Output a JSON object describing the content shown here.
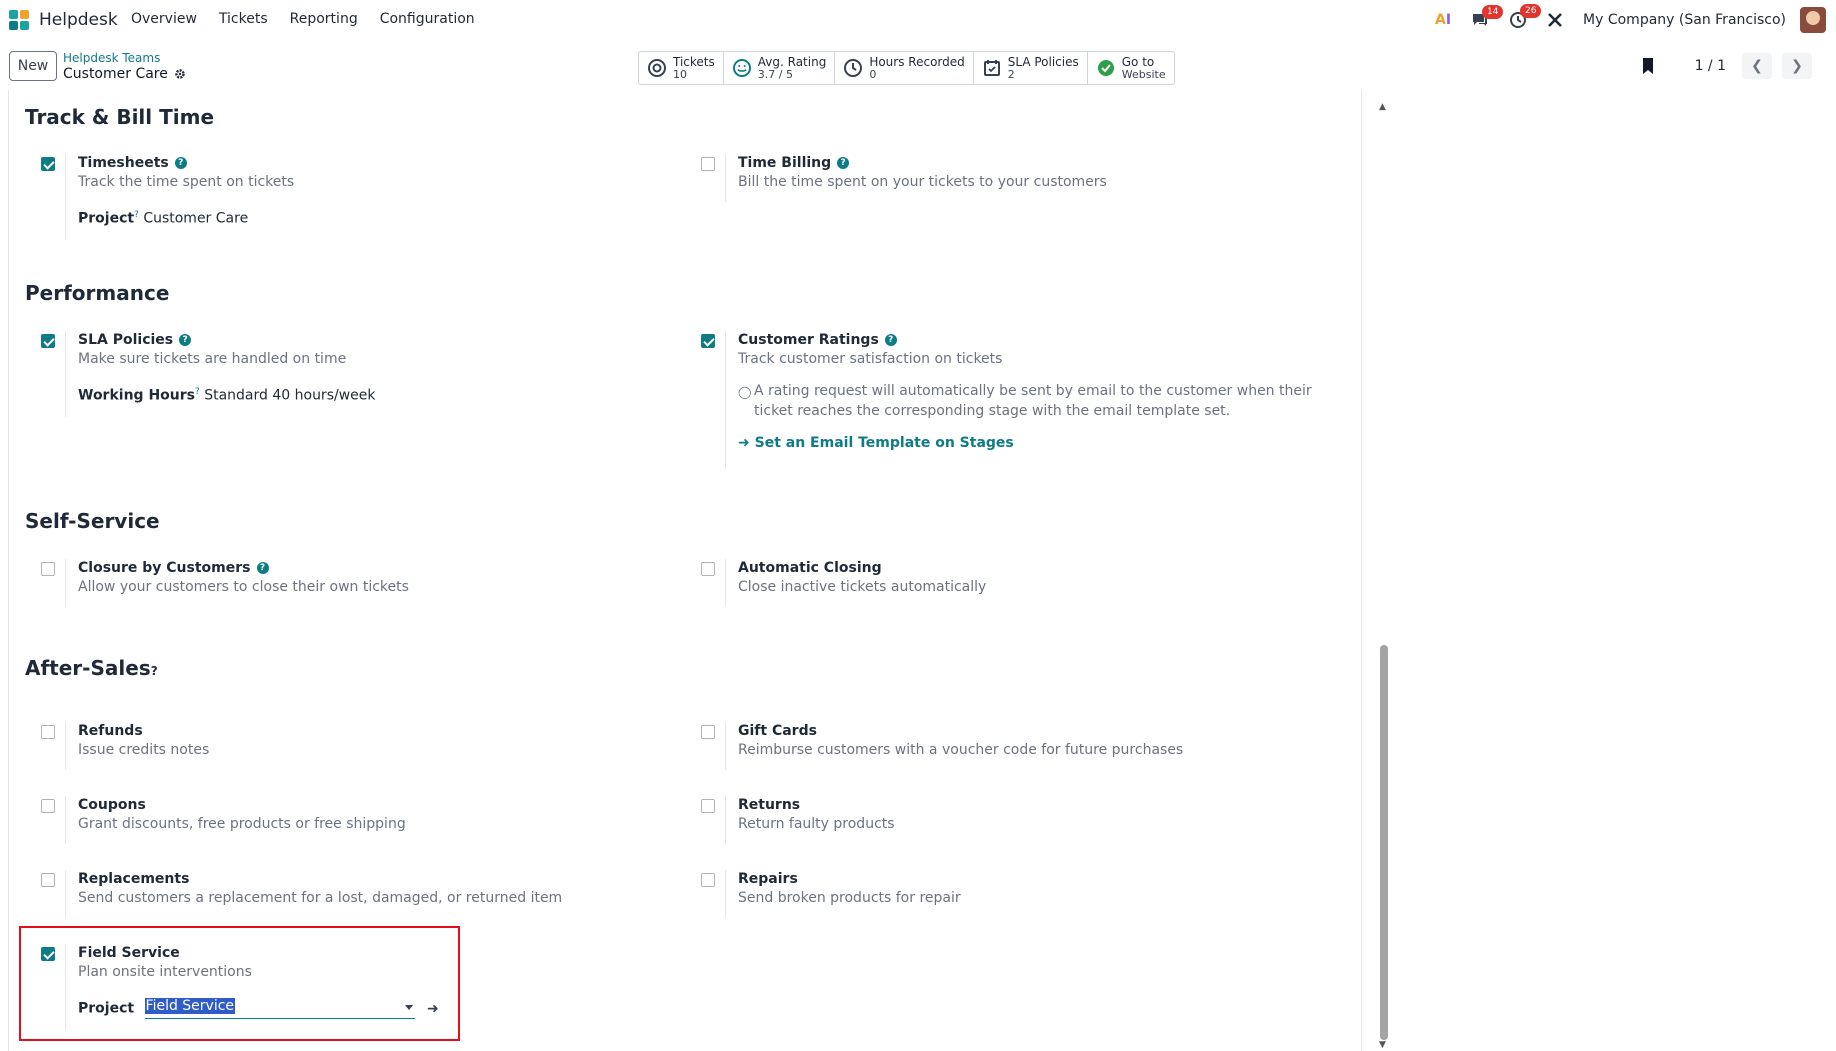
{
  "nav": {
    "app_name": "Helpdesk",
    "menu": [
      "Overview",
      "Tickets",
      "Reporting",
      "Configuration"
    ],
    "chat_badge": "14",
    "activity_badge": "26",
    "company": "My Company (San Francisco)"
  },
  "control_panel": {
    "new_label": "New",
    "breadcrumb_parent": "Helpdesk Teams",
    "breadcrumb_current": "Customer Care",
    "smart_buttons": [
      {
        "label": "Tickets",
        "value": "10",
        "icon": "lifebuoy-icon"
      },
      {
        "label": "Avg. Rating",
        "value": "3.7 / 5",
        "icon": "smile-icon"
      },
      {
        "label": "Hours Recorded",
        "value": "0",
        "icon": "clock-icon"
      },
      {
        "label": "SLA Policies",
        "value": "2",
        "icon": "calendar-check-icon"
      },
      {
        "label": "Go to",
        "value": "Website",
        "icon": "globe-icon"
      }
    ],
    "pager": "1 / 1"
  },
  "sections": {
    "track": {
      "title": "Track & Bill Time",
      "timesheets": {
        "title": "Timesheets",
        "desc": "Track the time spent on tickets",
        "checked": true,
        "field_label": "Project",
        "field_value": "Customer Care"
      },
      "time_billing": {
        "title": "Time Billing",
        "desc": "Bill the time spent on your tickets to your customers",
        "checked": false
      }
    },
    "performance": {
      "title": "Performance",
      "sla": {
        "title": "SLA Policies",
        "desc": "Make sure tickets are handled on time",
        "checked": true,
        "field_label": "Working Hours",
        "field_value": "Standard 40 hours/week"
      },
      "ratings": {
        "title": "Customer Ratings",
        "desc": "Track customer satisfaction on tickets",
        "checked": true,
        "note": "A rating request will automatically be sent by email to the customer when their ticket reaches the corresponding stage with the email template set.",
        "link": "Set an Email Template on Stages"
      }
    },
    "self_service": {
      "title": "Self-Service",
      "closure": {
        "title": "Closure by Customers",
        "desc": "Allow your customers to close their own tickets",
        "checked": false
      },
      "auto_close": {
        "title": "Automatic Closing",
        "desc": "Close inactive tickets automatically",
        "checked": false
      }
    },
    "after_sales": {
      "title": "After-Sales",
      "refunds": {
        "title": "Refunds",
        "desc": "Issue credits notes",
        "checked": false
      },
      "gift_cards": {
        "title": "Gift Cards",
        "desc": "Reimburse customers with a voucher code for future purchases",
        "checked": false
      },
      "coupons": {
        "title": "Coupons",
        "desc": "Grant discounts, free products or free shipping",
        "checked": false
      },
      "returns": {
        "title": "Returns",
        "desc": "Return faulty products",
        "checked": false
      },
      "replacements": {
        "title": "Replacements",
        "desc": "Send customers a replacement for a lost, damaged, or returned item",
        "checked": false
      },
      "repairs": {
        "title": "Repairs",
        "desc": "Send broken products for repair",
        "checked": false
      },
      "field_service": {
        "title": "Field Service",
        "desc": "Plan onsite interventions",
        "checked": true,
        "field_label": "Project",
        "field_value": "Field Service"
      }
    }
  },
  "colors": {
    "accent": "#0e7c86",
    "highlight_border": "#e3101c",
    "selection": "#2f5cc7"
  }
}
